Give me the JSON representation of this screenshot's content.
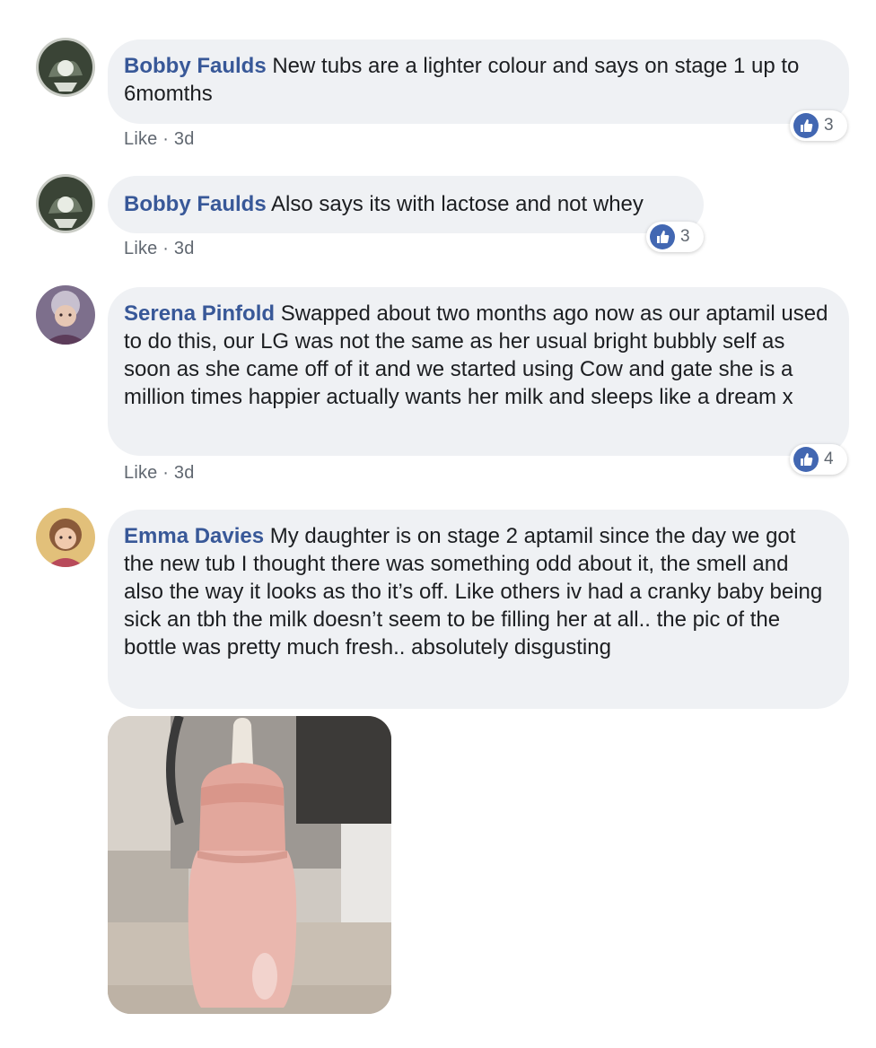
{
  "comments": [
    {
      "author": "Bobby Faulds",
      "text": "New tubs are a lighter colour and says on stage 1 up to 6momths",
      "like_label": "Like",
      "time": "3d",
      "reactions": "3"
    },
    {
      "author": "Bobby Faulds",
      "text": "Also says its with lactose and not whey",
      "like_label": "Like",
      "time": "3d",
      "reactions": "3"
    },
    {
      "author": "Serena Pinfold",
      "text": "Swapped about two months ago now as our aptamil used to do this, our LG was not the same as her usual bright bubbly self as soon as she came off of it and we started using Cow and gate she is a million times happier actually wants her milk and sleeps like a dream x",
      "like_label": "Like",
      "time": "3d",
      "reactions": "4"
    },
    {
      "author": "Emma Davies",
      "text": "My daughter is on stage 2 aptamil since the day we got the new tub I thought there was something odd about it, the smell and also the way it looks as tho it’s off. Like others iv had a cranky baby being sick an tbh the milk doesn’t seem to be filling her at all.. the pic of the bottle was pretty much fresh.. absolutely disgusting"
    }
  ],
  "meta_separator": "·",
  "colors": {
    "author_name": "#385898",
    "bubble_bg": "#eff1f4",
    "like_icon": "#4267b2",
    "meta_text": "#606770"
  },
  "icons": {
    "reaction": "thumbs-up-icon",
    "attachment": "baby-bottle-photo"
  }
}
